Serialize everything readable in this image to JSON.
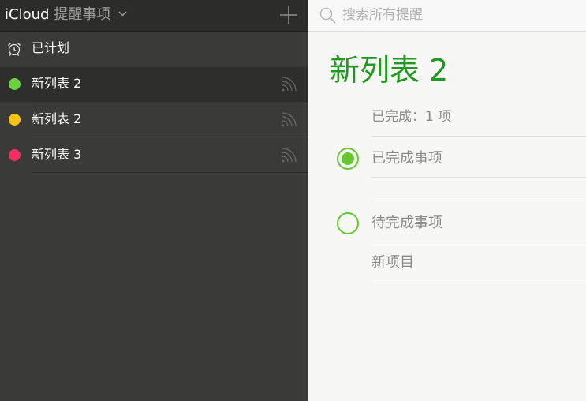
{
  "header": {
    "brand": "iCloud",
    "app_name": "提醒事项"
  },
  "sidebar": {
    "scheduled_label": "已计划",
    "lists": [
      {
        "name": "新列表 2",
        "color": "#6dd13f",
        "selected": true
      },
      {
        "name": "新列表 2",
        "color": "#f6c50d",
        "selected": false
      },
      {
        "name": "新列表 3",
        "color": "#f2305f",
        "selected": false
      }
    ]
  },
  "search": {
    "placeholder": "搜索所有提醒",
    "value": ""
  },
  "main": {
    "list_title": "新列表 2",
    "completed_count": "已完成：1 项",
    "items": [
      {
        "text": "已完成事项",
        "completed": true
      },
      {
        "text": "待完成事项",
        "completed": false
      }
    ],
    "new_item_placeholder": "新项目"
  },
  "colors": {
    "accent_green": "#1f9a1f",
    "checkbox_green": "#65c82c",
    "sidebar_bg": "#3a3a38"
  }
}
